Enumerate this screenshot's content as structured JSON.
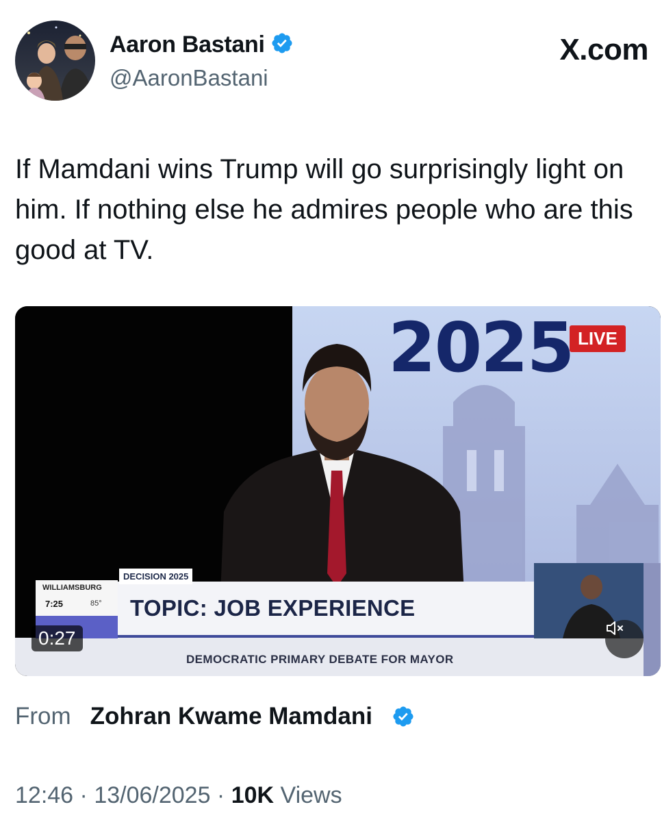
{
  "author": {
    "display_name": "Aaron Bastani",
    "handle": "@AaronBastani",
    "verified_icon": "verified-badge-icon"
  },
  "site_label": "X.com",
  "tweet": {
    "text": "If Mamdani wins Trump will go surprisingly light on him. If nothing else he admires people who are this good at TV."
  },
  "video": {
    "year_graphic": "2025",
    "live_badge": "LIVE",
    "decision_tag": "DECISION 2025",
    "topic": "TOPIC: JOB EXPERIENCE",
    "subtitle": "DEMOCRATIC PRIMARY DEBATE FOR MAYOR",
    "location": "WILLIAMSBURG",
    "local_time": "7:25",
    "local_temp": "85°",
    "duration": "0:27",
    "mute_icon": "speaker-muted-icon"
  },
  "source": {
    "from_label": "From",
    "name": "Zohran Kwame Mamdani"
  },
  "meta": {
    "time": "12:46",
    "sep1": " · ",
    "date": "13/06/2025",
    "sep2": " · ",
    "views_count": "10K",
    "views_label": " Views"
  },
  "colors": {
    "accent_blue": "#1d9bf0",
    "secondary_text": "#536471",
    "live_red": "#d32224"
  }
}
